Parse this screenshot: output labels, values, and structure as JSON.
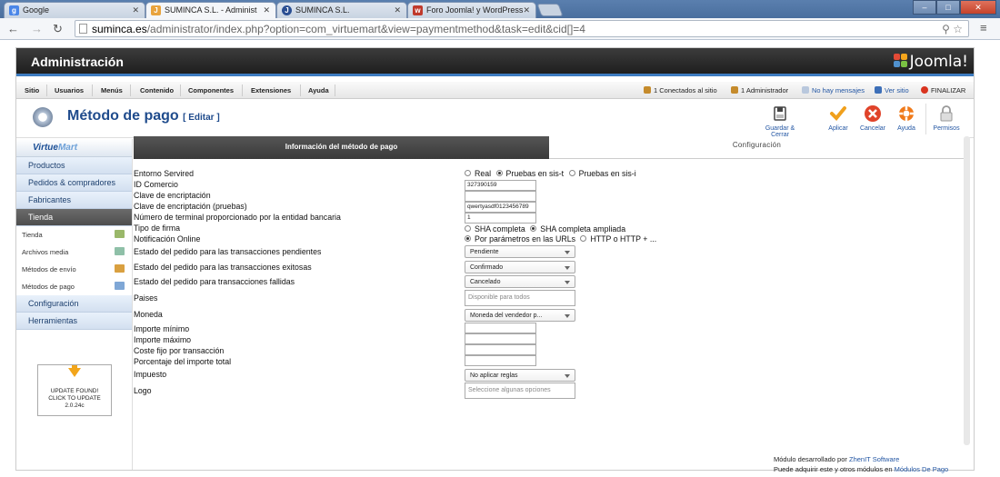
{
  "browser": {
    "tabs": [
      {
        "label": "Google",
        "icon": "google-icon",
        "color": "#4a86e8",
        "glyph": "g"
      },
      {
        "label": "SUMINCA S.L. - Administ",
        "icon": "joomla-icon",
        "color": "#e8a33d",
        "glyph": "J"
      },
      {
        "label": "SUMINCA S.L.",
        "icon": "joomla-icon",
        "color": "#2a4e92",
        "glyph": "J"
      },
      {
        "label": "Foro Joomla! y WordPress",
        "icon": "forum-icon",
        "color": "#c0392b",
        "glyph": "w"
      }
    ],
    "url_host": "suminca.es",
    "url_path": "/administrator/index.php?option=com_virtuemart&view=paymentmethod&task=edit&cid[]=4"
  },
  "admin": {
    "title": "Administración",
    "logo": "Joomla!",
    "topmenu": [
      "Sitio",
      "Usuarios",
      "Menús",
      "Contenido",
      "Componentes",
      "Extensiones",
      "Ayuda"
    ],
    "status": {
      "connected": "1 Conectados al sitio",
      "admins": "1 Administrador",
      "messages": "No hay mensajes",
      "site": "Ver sitio",
      "logout": "FINALIZAR"
    }
  },
  "header": {
    "title": "Método de pago",
    "subtitle": "[ Editar ]",
    "toolbar": [
      "Guardar & Cerrar",
      "Aplicar",
      "Cancelar",
      "Ayuda",
      "Permisos"
    ]
  },
  "sidebar": {
    "logo_a": "Virtue",
    "logo_b": "Mart",
    "items": [
      "Productos",
      "Pedidos & compradores",
      "Fabricantes",
      "Tienda"
    ],
    "subitems": [
      "Tienda",
      "Archivos media",
      "Métodos de envío",
      "Métodos de pago"
    ],
    "items2": [
      "Configuración",
      "Herramientas"
    ],
    "update": {
      "line1": "UPDATE FOUND!",
      "line2": "CLICK TO UPDATE",
      "version": "2.0.24c"
    }
  },
  "tabs": {
    "info": "Información del método de pago",
    "config": "Configuración"
  },
  "form": {
    "entorno": {
      "label": "Entorno Servired",
      "options": [
        "Real",
        "Pruebas en sis-t",
        "Pruebas en sis-i"
      ]
    },
    "id_comercio": {
      "label": "ID Comercio",
      "value": "327390159"
    },
    "clave": {
      "label": "Clave de encriptación",
      "value": ""
    },
    "clave_pruebas": {
      "label": "Clave de encriptación (pruebas)",
      "value": "qwertyasdf0123456789"
    },
    "terminal": {
      "label": "Número de terminal proporcionado por la entidad bancaria",
      "value": "1"
    },
    "firma": {
      "label": "Tipo de firma",
      "options": [
        "SHA completa",
        "SHA completa ampliada"
      ]
    },
    "notificacion": {
      "label": "Notificación Online",
      "options": [
        "Por parámetros en las URLs",
        "HTTP o HTTP + ..."
      ]
    },
    "pendientes": {
      "label": "Estado del pedido para las transacciones pendientes",
      "value": "Pendiente"
    },
    "exitosas": {
      "label": "Estado del pedido para las transacciones exitosas",
      "value": "Confirmado"
    },
    "fallidas": {
      "label": "Estado del pedido para transacciones fallidas",
      "value": "Cancelado"
    },
    "paises": {
      "label": "Paises",
      "placeholder": "Disponible para todos"
    },
    "moneda": {
      "label": "Moneda",
      "value": "Moneda del vendedor p..."
    },
    "importe_min": {
      "label": "Importe mínimo",
      "value": ""
    },
    "importe_max": {
      "label": "Importe máximo",
      "value": ""
    },
    "coste_fijo": {
      "label": "Coste fijo por transacción",
      "value": ""
    },
    "porcentaje": {
      "label": "Porcentaje del importe total",
      "value": ""
    },
    "impuesto": {
      "label": "Impuesto",
      "value": "No aplicar reglas"
    },
    "logo": {
      "label": "Logo",
      "placeholder": "Seleccione algunas opciones"
    }
  },
  "credits": {
    "line1_a": "Módulo desarrollado por",
    "line1_link": "ZhenIT Software",
    "line2_a": "Puede adquirir este y otros módulos en",
    "line2_link": "Módulos De Pago"
  }
}
